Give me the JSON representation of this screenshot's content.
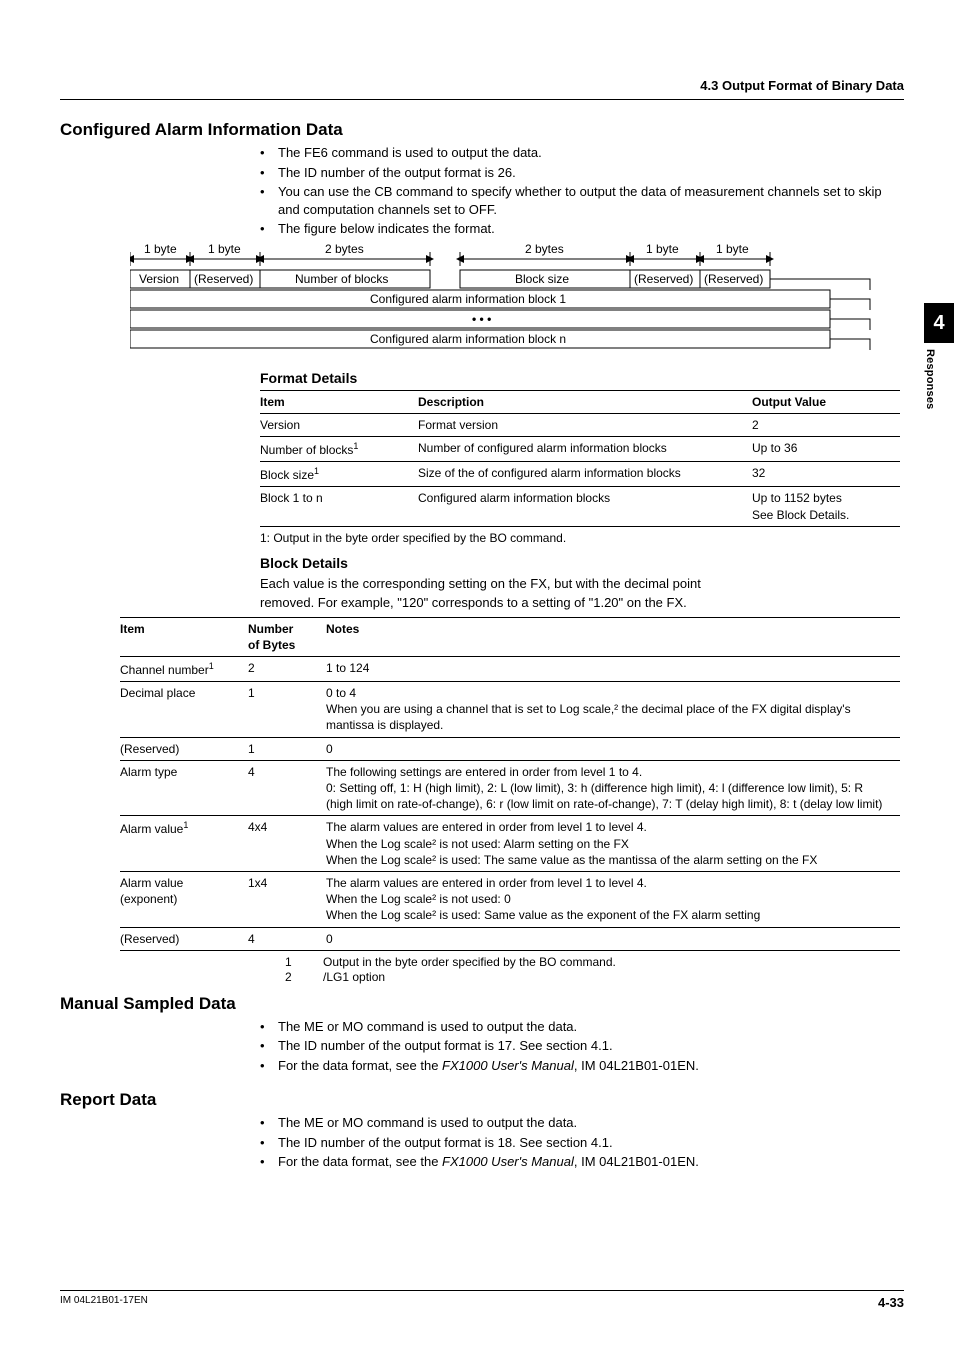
{
  "header": {
    "section": "4.3  Output Format of Binary Data"
  },
  "sideTab": {
    "chapter": "4",
    "label": "Responses"
  },
  "s1": {
    "title": "Configured Alarm Information Data",
    "bullets": [
      "The FE6 command is used to output the data.",
      "The ID number of the output format is 26.",
      "You can use the CB command to specify whether to output the data of measurement channels set to skip and computation channels set to OFF.",
      "The figure below indicates the format."
    ]
  },
  "diagram": {
    "top": {
      "b1": "1 byte",
      "b2": "1 byte",
      "b3": "2 bytes",
      "b4": "2 bytes",
      "b5": "1 byte",
      "b6": "1 byte"
    },
    "row1": {
      "c1": "Version",
      "c2": "(Reserved)",
      "c3": "Number of blocks",
      "c4": "Block size",
      "c5": "(Reserved)",
      "c6": "(Reserved)"
    },
    "row2": "Configured alarm information block 1",
    "row3": "• • •",
    "row4": "Configured alarm information block n"
  },
  "formatDetails": {
    "title": "Format Details",
    "headers": [
      "Item",
      "Description",
      "Output Value"
    ],
    "rows": [
      {
        "item": "Version",
        "sup": "",
        "desc": "Format version",
        "val": "2"
      },
      {
        "item": "Number of blocks",
        "sup": "1",
        "desc": "Number of configured alarm information blocks",
        "val": "Up to 36"
      },
      {
        "item": "Block size",
        "sup": "1",
        "desc": "Size of the of configured alarm information blocks",
        "val": "32"
      },
      {
        "item": "Block 1 to n",
        "sup": "",
        "desc": "Configured alarm information blocks",
        "val": "Up to 1152 bytes See Block Details."
      }
    ],
    "footnote": "1: Output in the byte order specified by the BO command."
  },
  "blockDetails": {
    "title": "Block Details",
    "intro1": "Each value is the corresponding setting on the FX, but with the decimal point",
    "intro2": "removed. For example, \"120\" corresponds to a setting of \"1.20\" on the FX.",
    "headers": [
      "Item",
      "Number of Bytes",
      "Notes"
    ],
    "rows": [
      {
        "item": "Channel number",
        "sup": "1",
        "bytes": "2",
        "notes": "1 to 124"
      },
      {
        "item": "Decimal place",
        "sup": "",
        "bytes": "1",
        "notes": "0 to 4\nWhen you are using a channel that is set to Log scale,² the decimal place of the FX digital display's mantissa is displayed."
      },
      {
        "item": "(Reserved)",
        "sup": "",
        "bytes": "1",
        "notes": "0"
      },
      {
        "item": "Alarm type",
        "sup": "",
        "bytes": "4",
        "notes": "The following settings are entered in order from level 1 to 4.\n0: Setting off, 1: H (high limit), 2: L (low limit), 3: h (difference high limit), 4: l (difference low limit), 5: R (high limit on rate-of-change), 6: r (low limit on rate-of-change), 7: T (delay high limit), 8: t (delay low limit)"
      },
      {
        "item": "Alarm value",
        "sup": "1",
        "bytes": "4x4",
        "notes": "The alarm values are entered in order from level 1 to level 4.\nWhen the Log scale² is not used: Alarm setting on the FX\nWhen the Log scale² is used: The same value as the mantissa of the alarm setting on the FX"
      },
      {
        "item": "Alarm value (exponent)",
        "sup": "",
        "bytes": "1x4",
        "notes": "The alarm values are entered in order from level 1 to level 4.\nWhen the Log scale² is not used: 0\nWhen the Log scale² is used: Same value as the exponent of the FX alarm setting"
      },
      {
        "item": "(Reserved)",
        "sup": "",
        "bytes": "4",
        "notes": "0"
      }
    ],
    "footnotes": [
      {
        "n": "1",
        "t": "Output in the byte order specified by the BO command."
      },
      {
        "n": "2",
        "t": "/LG1 option"
      }
    ]
  },
  "s2": {
    "title": "Manual Sampled Data",
    "bullets": [
      "The ME or MO command is used to output the data.",
      "The ID number of the output format is 17. See section 4.1.",
      "For the data format, see the <i>FX1000 User's Manual</i>, IM 04L21B01-01EN."
    ]
  },
  "s3": {
    "title": "Report Data",
    "bullets": [
      "The ME or MO command is used to output the data.",
      "The ID number of the output format is 18. See section 4.1.",
      "For the data format, see the <i>FX1000 User's Manual</i>, IM 04L21B01-01EN."
    ]
  },
  "footer": {
    "left": "IM 04L21B01-17EN",
    "right": "4-33"
  }
}
